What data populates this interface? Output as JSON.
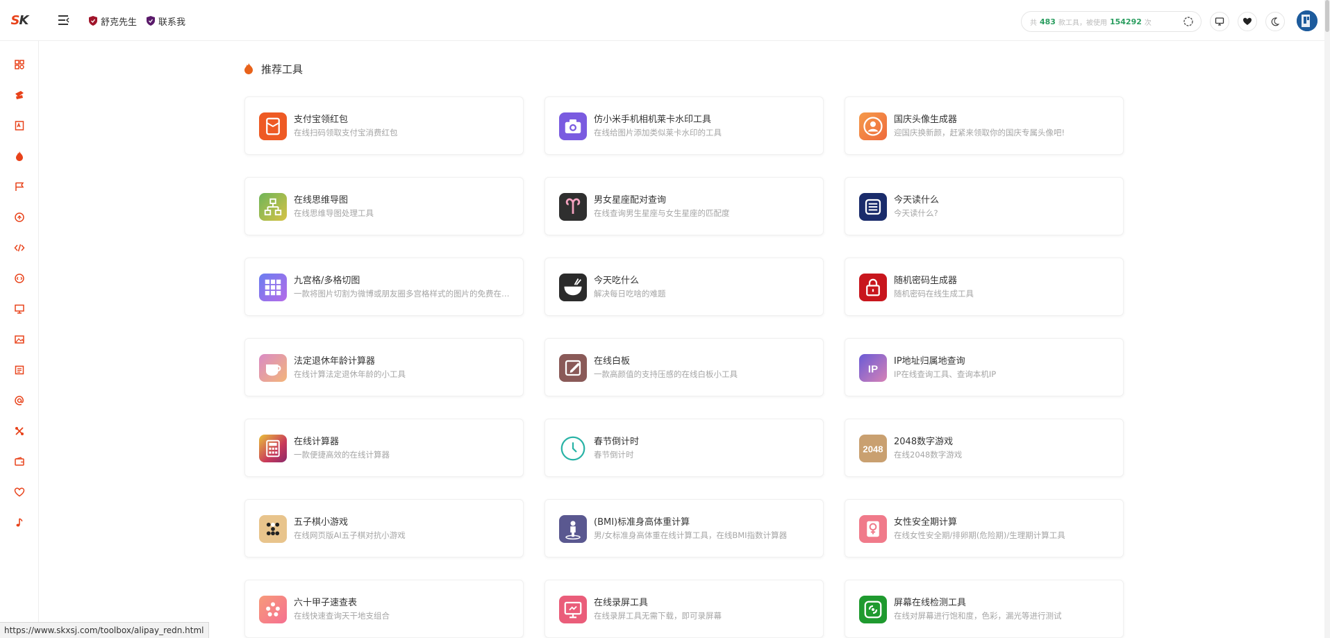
{
  "topbar": {
    "logo_a": "S",
    "logo_b": "K",
    "nav": [
      {
        "label": "舒克先生"
      },
      {
        "label": "联系我"
      }
    ],
    "search": {
      "prefix": "共",
      "tool_count": "483",
      "middle": "款工具，被使用",
      "use_count": "154292",
      "suffix": "次"
    }
  },
  "section": {
    "title": "推荐工具"
  },
  "cards": [
    {
      "title": "支付宝领红包",
      "desc": "在线扫码领取支付宝消费红包",
      "icon": "red-envelope-icon",
      "color": "#ee5a24"
    },
    {
      "title": "仿小米手机相机莱卡水印工具",
      "desc": "在线给图片添加类似莱卡水印的工具",
      "icon": "camera-icon",
      "color": "#7a5be0"
    },
    {
      "title": "国庆头像生成器",
      "desc": "迎国庆换新颜，赶紧来领取你的国庆专属头像吧!",
      "icon": "user-avatar-icon",
      "color": "#f07a3c"
    },
    {
      "title": "在线思维导图",
      "desc": "在线思维导图处理工具",
      "icon": "mind-map-icon",
      "color": "#8cbf4a"
    },
    {
      "title": "男女星座配对查询",
      "desc": "在线查询男生星座与女生星座的匹配度",
      "icon": "aries-icon",
      "color": "#2f2f2f"
    },
    {
      "title": "今天读什么",
      "desc": "今天读什么?",
      "icon": "book-icon",
      "color": "#1a2c6b"
    },
    {
      "title": "九宫格/多格切图",
      "desc": "一款将图片切割为微博或朋友圈多宫格样式的图片的免费在线工具",
      "icon": "grid-icon",
      "color": "#8e6be8"
    },
    {
      "title": "今天吃什么",
      "desc": "解决每日吃啥的难题",
      "icon": "bowl-icon",
      "color": "#2b2b2b"
    },
    {
      "title": "随机密码生成器",
      "desc": "随机密码在线生成工具",
      "icon": "lock-icon",
      "color": "#c8161d"
    },
    {
      "title": "法定退休年龄计算器",
      "desc": "在线计算法定退休年龄的小工具",
      "icon": "coffee-cup-icon",
      "color": "#d98bc5"
    },
    {
      "title": "在线白板",
      "desc": "一款高颜值的支持压感的在线白板小工具",
      "icon": "whiteboard-icon",
      "color": "#8a5a58"
    },
    {
      "title": "IP地址归属地查询",
      "desc": "IP在线查询工具、查询本机IP",
      "icon": "ip-icon",
      "color": "#6a5bd6"
    },
    {
      "title": "在线计算器",
      "desc": "一款便捷高效的在线计算器",
      "icon": "calculator-icon",
      "color": "#c93a5a"
    },
    {
      "title": "春节倒计时",
      "desc": "春节倒计时",
      "icon": "clock-icon",
      "color": "#2ab3a6"
    },
    {
      "title": "2048数字游戏",
      "desc": "在线2048数字游戏",
      "icon": "game-2048-icon",
      "color": "#c9a070"
    },
    {
      "title": "五子棋小游戏",
      "desc": "在线网页版AI五子棋对抗小游戏",
      "icon": "gomoku-icon",
      "color": "#e8c48c"
    },
    {
      "title": "(BMI)标准身高体重计算",
      "desc": "男/女标准身高体重在线计算工具，在线BMI指数计算器",
      "icon": "person-icon",
      "color": "#5a5890"
    },
    {
      "title": "女性安全期计算",
      "desc": "在线女性安全期/排卵期(危险期)/生理期计算工具",
      "icon": "female-icon",
      "color": "#f07a8a"
    },
    {
      "title": "六十甲子速查表",
      "desc": "在线快速查询天干地支组合",
      "icon": "dots-icon",
      "color": "#f58080"
    },
    {
      "title": "在线录屏工具",
      "desc": "在线录屏工具无需下载，即可录屏幕",
      "icon": "screen-record-icon",
      "color": "#ea5d7a"
    },
    {
      "title": "屏幕在线检测工具",
      "desc": "在线对屏幕进行饱和度，色彩，漏光等进行测试",
      "icon": "screen-check-icon",
      "color": "#1f9a2f"
    }
  ],
  "sidebar": {
    "items": [
      {
        "icon": "dashboard-icon"
      },
      {
        "icon": "coupon-icon"
      },
      {
        "icon": "document-icon"
      },
      {
        "icon": "flame-icon"
      },
      {
        "icon": "flag-icon"
      },
      {
        "icon": "coin-icon"
      },
      {
        "icon": "code-icon"
      },
      {
        "icon": "api-icon"
      },
      {
        "icon": "monitor-icon"
      },
      {
        "icon": "image-icon"
      },
      {
        "icon": "notes-icon"
      },
      {
        "icon": "at-icon"
      },
      {
        "icon": "tools-icon"
      },
      {
        "icon": "wallet-icon"
      },
      {
        "icon": "heart-icon"
      },
      {
        "icon": "music-icon"
      }
    ]
  },
  "status_bar": {
    "url": "https://www.skxsj.com/toolbox/alipay_redn.html"
  }
}
